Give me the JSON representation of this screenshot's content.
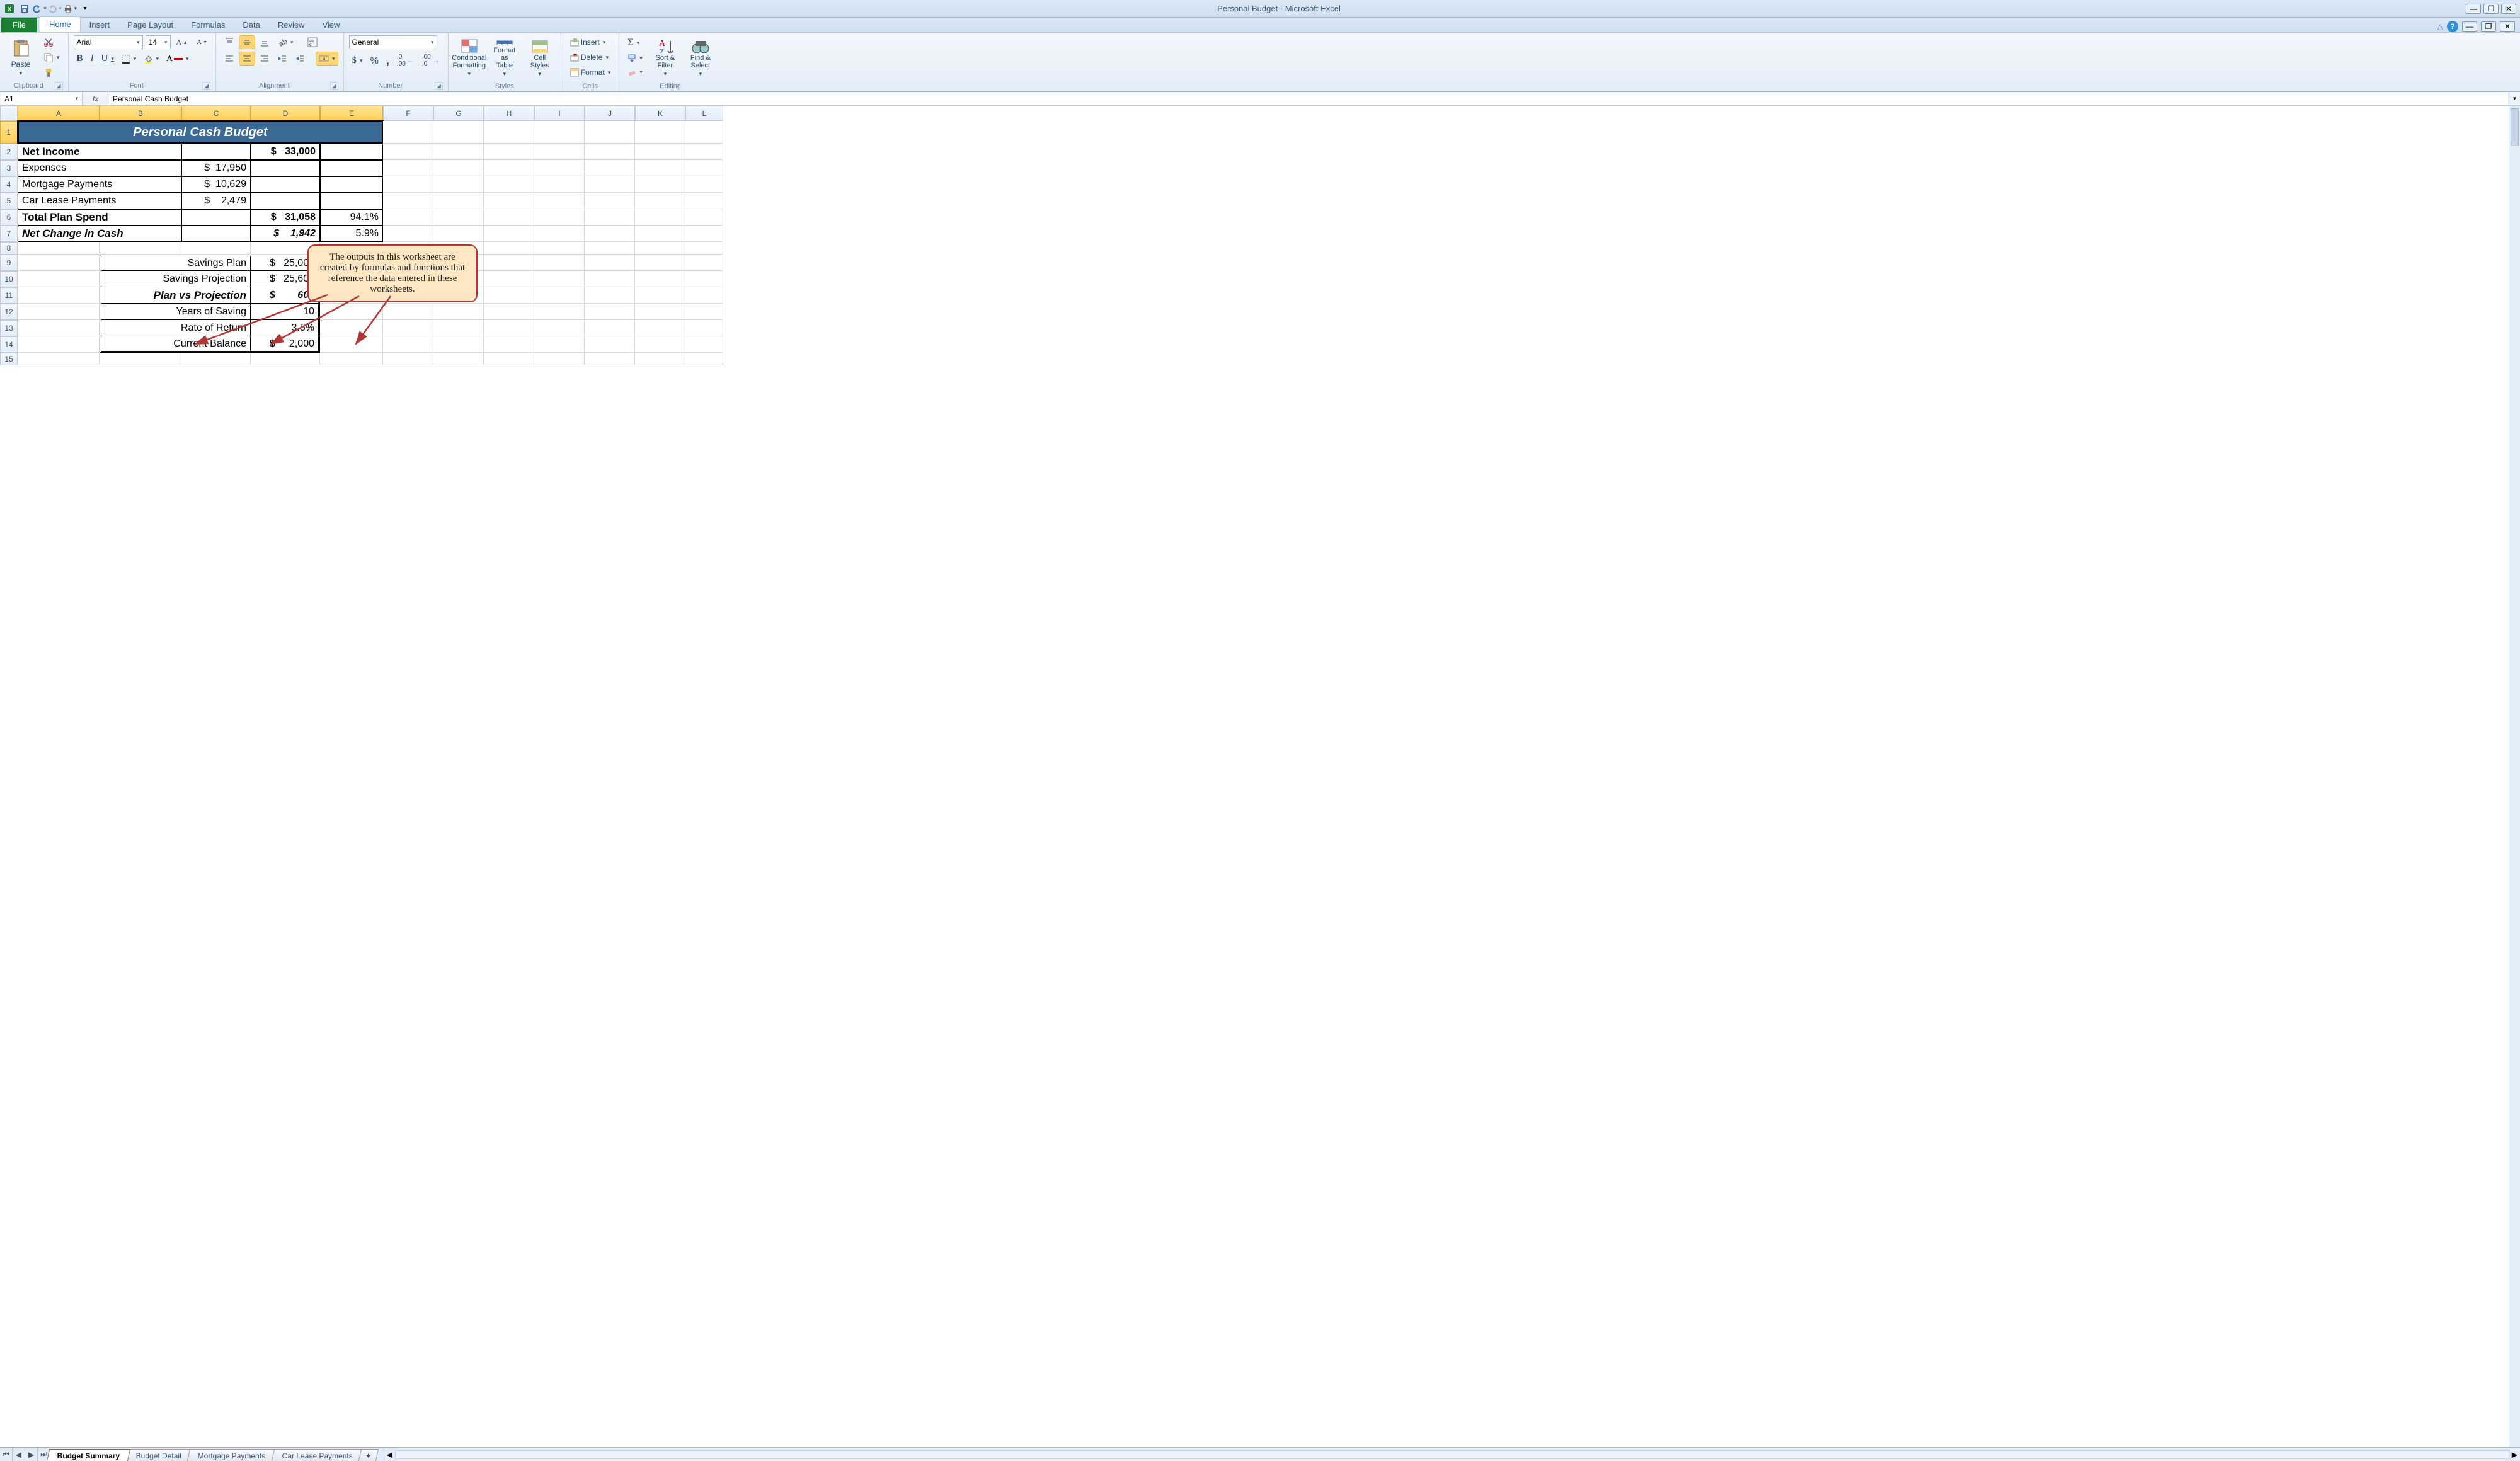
{
  "title": "Personal Budget - Microsoft Excel",
  "qat": {
    "save": "Save",
    "undo": "Undo",
    "redo": "Redo",
    "print": "Quick Print"
  },
  "tabs": {
    "file": "File",
    "home": "Home",
    "insert": "Insert",
    "pageLayout": "Page Layout",
    "formulas": "Formulas",
    "data": "Data",
    "review": "Review",
    "view": "View"
  },
  "ribbon": {
    "clipboard": {
      "label": "Clipboard",
      "paste": "Paste"
    },
    "font": {
      "label": "Font",
      "name": "Arial",
      "size": "14",
      "bold": "B",
      "italic": "I",
      "underline": "U"
    },
    "alignment": {
      "label": "Alignment"
    },
    "number": {
      "label": "Number",
      "format": "General"
    },
    "styles": {
      "label": "Styles",
      "cond": "Conditional Formatting",
      "table": "Format as Table",
      "cellStyles": "Cell Styles"
    },
    "cells": {
      "label": "Cells",
      "insert": "Insert",
      "delete": "Delete",
      "format": "Format"
    },
    "editing": {
      "label": "Editing",
      "sort": "Sort & Filter",
      "find": "Find & Select"
    }
  },
  "namebox": "A1",
  "formula": "Personal Cash Budget",
  "columns": [
    "A",
    "B",
    "C",
    "D",
    "E",
    "F",
    "G",
    "H",
    "I",
    "J",
    "K",
    "L"
  ],
  "rows": [
    "1",
    "2",
    "3",
    "4",
    "5",
    "6",
    "7",
    "8",
    "9",
    "10",
    "11",
    "12",
    "13",
    "14",
    "15"
  ],
  "sheet": {
    "title": "Personal Cash Budget",
    "r2a": "Net Income",
    "r2d": "$   33,000",
    "r3a": "Expenses",
    "r3c": "$  17,950",
    "r4a": "Mortgage Payments",
    "r4c": "$  10,629",
    "r5a": "Car Lease Payments",
    "r5c": "$    2,479",
    "r6a": "Total Plan Spend",
    "r6d": "$   31,058",
    "r6e": "94.1%",
    "r7a": "Net Change in Cash",
    "r7d": "$    1,942",
    "r7e": "5.9%",
    "r9bc": "Savings Plan",
    "r9d": "$   25,000",
    "r10bc": "Savings Projection",
    "r10d": "$   25,606",
    "r11bc": "Plan vs Projection",
    "r11d": "$        606",
    "r12bc": "Years of Saving",
    "r12d": "10",
    "r13bc": "Rate of Return",
    "r13d": "3.5%",
    "r14bc": "Current Balance",
    "r14d": "$     2,000"
  },
  "callout": "The outputs in this worksheet are created by formulas and functions that reference the data entered in these worksheets.",
  "sheetTabs": [
    "Budget Summary",
    "Budget Detail",
    "Mortgage Payments",
    "Car Lease Payments"
  ]
}
